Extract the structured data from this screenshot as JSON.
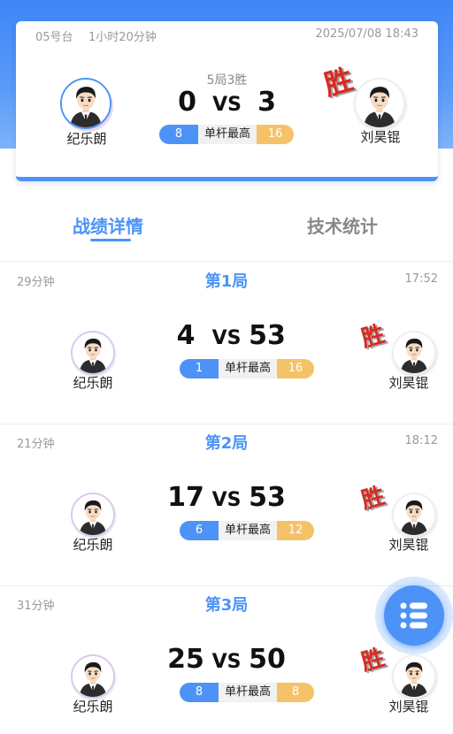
{
  "summary": {
    "table": "05号台",
    "duration": "1小时20分钟",
    "datetime": "2025/07/08 18:43",
    "rule": "5局3胜",
    "player_left": {
      "name": "纪乐朗",
      "avatar_icon": "player-avatar-icon",
      "score": "0",
      "highest_break": "8"
    },
    "player_right": {
      "name": "刘昊锟",
      "avatar_icon": "player-avatar-icon",
      "score": "3",
      "highest_break": "16"
    },
    "vs_label": "VS",
    "break_label": "单杆最高",
    "winner_label": "胜",
    "winner": "right"
  },
  "tabs": [
    {
      "label": "战绩详情",
      "active": true
    },
    {
      "label": "技术统计",
      "active": false
    }
  ],
  "games": [
    {
      "title": "第1局",
      "duration": "29分钟",
      "time": "17:52",
      "left": {
        "name": "纪乐朗",
        "score": "4",
        "highest_break": "1"
      },
      "right": {
        "name": "刘昊锟",
        "score": "53",
        "highest_break": "16"
      },
      "vs_label": "VS",
      "break_label": "单杆最高",
      "winner_label": "胜",
      "winner": "right"
    },
    {
      "title": "第2局",
      "duration": "21分钟",
      "time": "18:12",
      "left": {
        "name": "纪乐朗",
        "score": "17",
        "highest_break": "6"
      },
      "right": {
        "name": "刘昊锟",
        "score": "53",
        "highest_break": "12"
      },
      "vs_label": "VS",
      "break_label": "单杆最高",
      "winner_label": "胜",
      "winner": "right"
    },
    {
      "title": "第3局",
      "duration": "31分钟",
      "time": "",
      "left": {
        "name": "纪乐朗",
        "score": "25",
        "highest_break": "8"
      },
      "right": {
        "name": "刘昊锟",
        "score": "50",
        "highest_break": "8"
      },
      "vs_label": "VS",
      "break_label": "单杆最高",
      "winner_label": "胜",
      "winner": "right"
    }
  ],
  "fab": {
    "icon": "list-menu-icon"
  },
  "colors": {
    "accent_blue": "#4d93f7",
    "break_orange": "#f5c267",
    "win_red": "#d72a22",
    "header_gradient_top": "#3f86f7"
  }
}
